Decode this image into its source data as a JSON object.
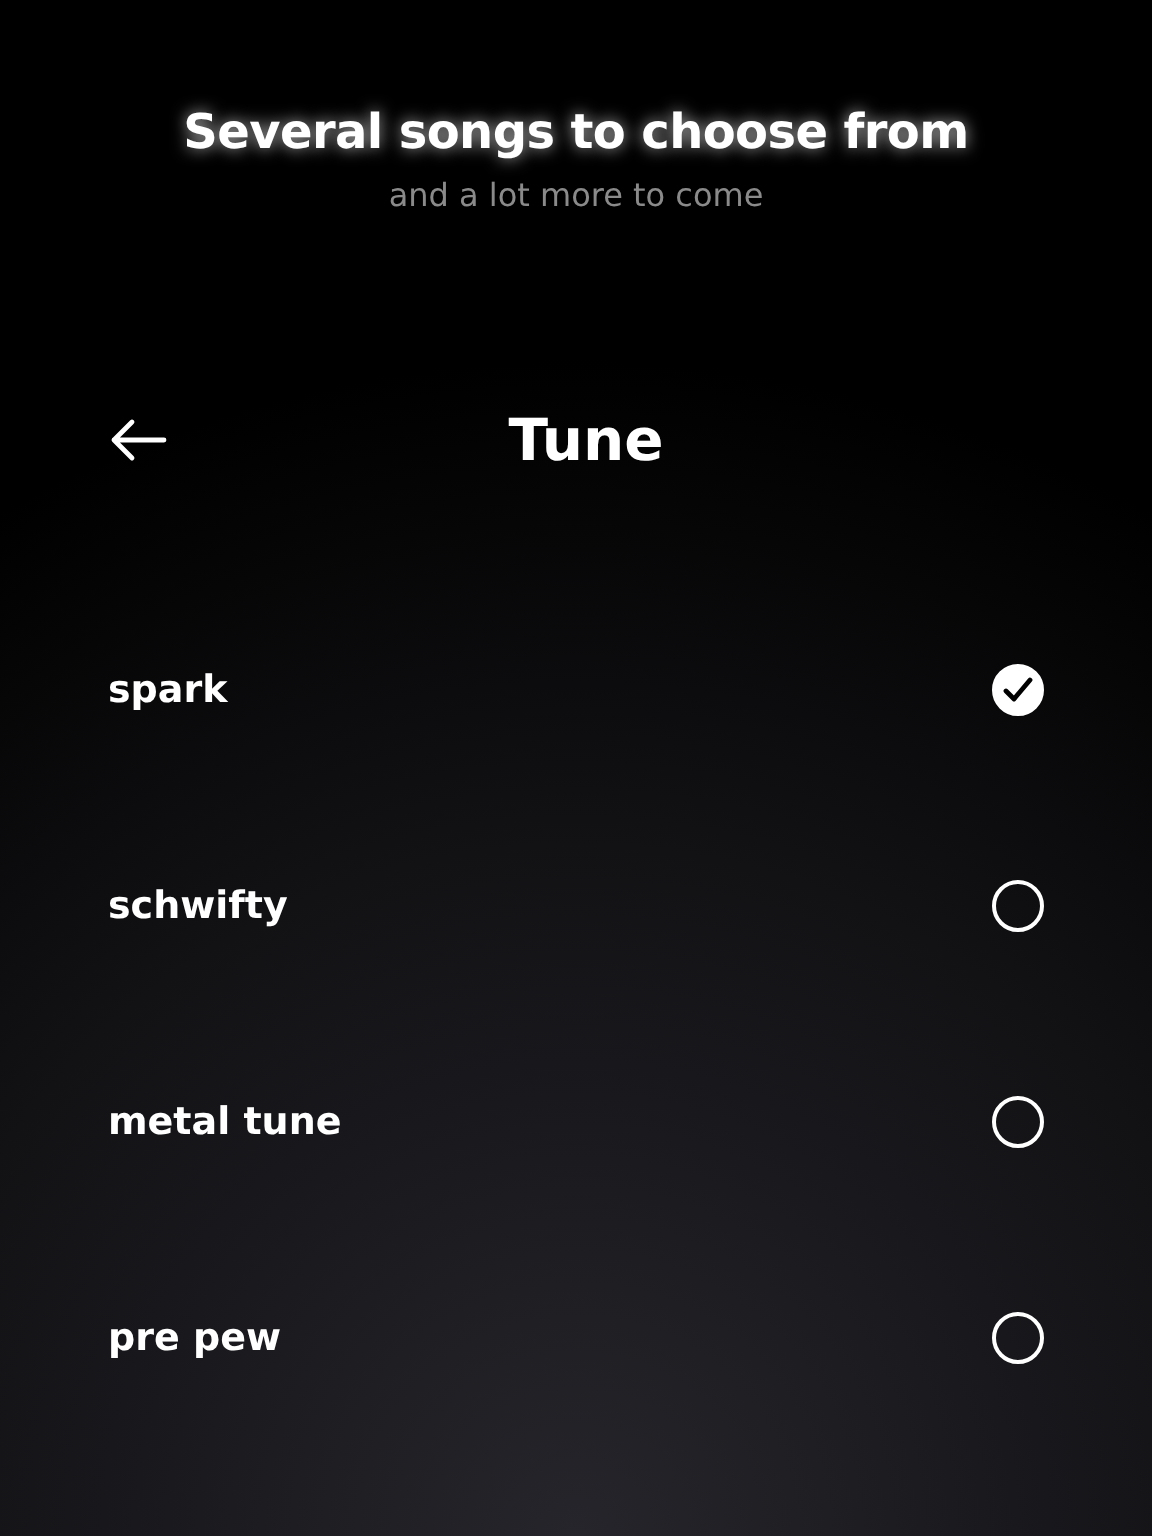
{
  "headline": {
    "title": "Several songs to choose from",
    "subtitle": "and a lot more to come"
  },
  "header": {
    "title": "Tune"
  },
  "options": [
    {
      "label": "spark",
      "selected": true
    },
    {
      "label": "schwifty",
      "selected": false
    },
    {
      "label": "metal tune",
      "selected": false
    },
    {
      "label": "pre pew",
      "selected": false
    }
  ]
}
